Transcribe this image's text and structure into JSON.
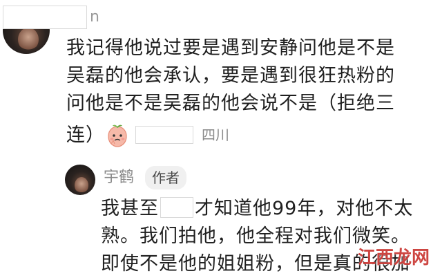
{
  "comment": {
    "username_suffix": "n",
    "line1": "我记得他说过要是遇到安静问他是不是",
    "line2": "吴磊的他会承认，要是遇到很狂热粉的",
    "line3": "问他是不是吴磊的他会说不是（拒绝三",
    "line4": "连）",
    "location": "四川",
    "sticker_icon": "peach-face-sticker-icon"
  },
  "reply": {
    "username": "宇鹤",
    "badge": "作者",
    "line1_before": "我甚至",
    "line1_after": "才知道他99年，对他不太",
    "line2": "熟。我们拍他，他全程对我们微笑。",
    "line3": "即使不是他的姐姐粉，但是真的很加"
  },
  "watermark": {
    "text": "江西龙网",
    "color": "#c42420"
  }
}
